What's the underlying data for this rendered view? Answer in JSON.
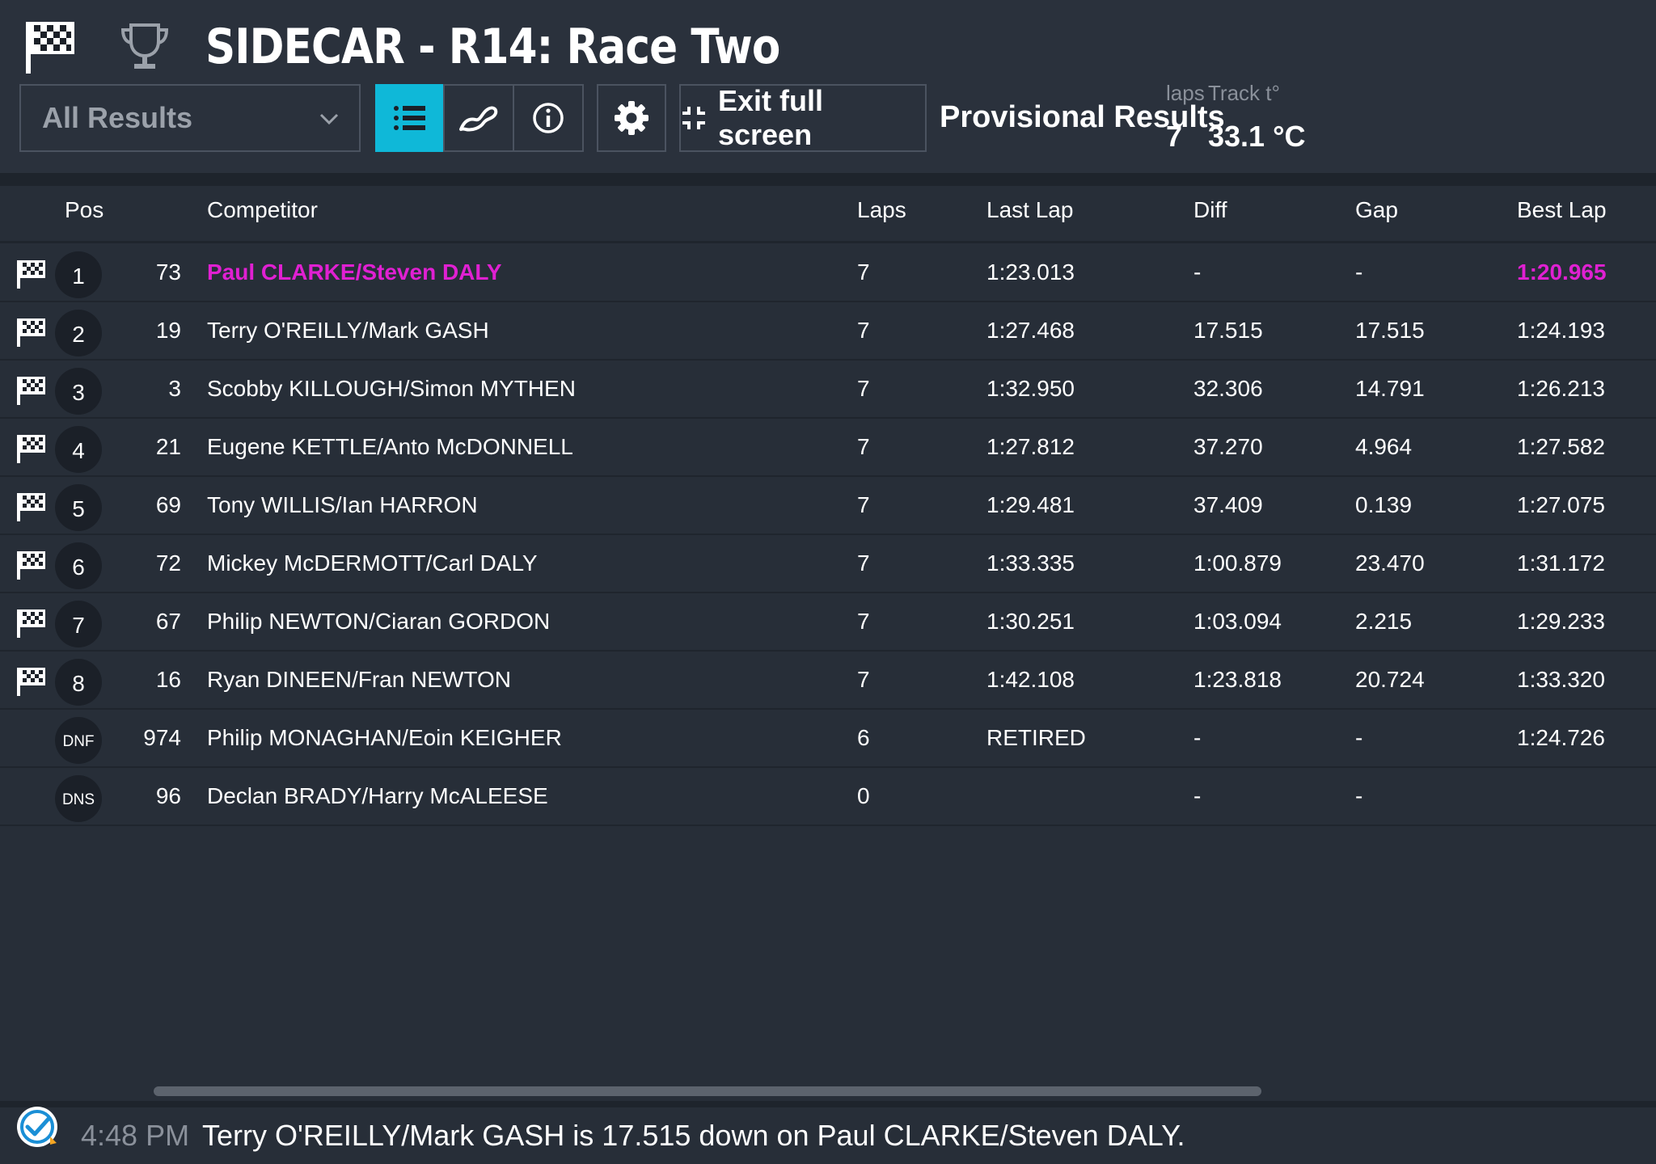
{
  "header": {
    "title": "SIDECAR - R14: Race Two",
    "dropdown_label": "All Results",
    "exit_label": "Exit full screen",
    "status": "Provisional Results",
    "laps_label": "laps",
    "laps_value": "7",
    "track_label": "Track t°",
    "track_value": "33.1 °C",
    "active_view": "list"
  },
  "columns": {
    "pos": "Pos",
    "competitor": "Competitor",
    "laps": "Laps",
    "last_lap": "Last Lap",
    "diff": "Diff",
    "gap": "Gap",
    "best_lap": "Best Lap"
  },
  "rows": [
    {
      "pos": "1",
      "num": "73",
      "competitor": "Paul CLARKE/Steven DALY",
      "laps": "7",
      "last": "1:23.013",
      "diff": "-",
      "gap": "-",
      "best": "1:20.965",
      "flag": true,
      "leader": true
    },
    {
      "pos": "2",
      "num": "19",
      "competitor": "Terry O'REILLY/Mark GASH",
      "laps": "7",
      "last": "1:27.468",
      "diff": "17.515",
      "gap": "17.515",
      "best": "1:24.193",
      "flag": true
    },
    {
      "pos": "3",
      "num": "3",
      "competitor": "Scobby KILLOUGH/Simon MYTHEN",
      "laps": "7",
      "last": "1:32.950",
      "diff": "32.306",
      "gap": "14.791",
      "best": "1:26.213",
      "flag": true
    },
    {
      "pos": "4",
      "num": "21",
      "competitor": "Eugene KETTLE/Anto McDONNELL",
      "laps": "7",
      "last": "1:27.812",
      "diff": "37.270",
      "gap": "4.964",
      "best": "1:27.582",
      "flag": true
    },
    {
      "pos": "5",
      "num": "69",
      "competitor": "Tony WILLIS/Ian HARRON",
      "laps": "7",
      "last": "1:29.481",
      "diff": "37.409",
      "gap": "0.139",
      "best": "1:27.075",
      "flag": true
    },
    {
      "pos": "6",
      "num": "72",
      "competitor": "Mickey McDERMOTT/Carl DALY",
      "laps": "7",
      "last": "1:33.335",
      "diff": "1:00.879",
      "gap": "23.470",
      "best": "1:31.172",
      "flag": true
    },
    {
      "pos": "7",
      "num": "67",
      "competitor": "Philip NEWTON/Ciaran GORDON",
      "laps": "7",
      "last": "1:30.251",
      "diff": "1:03.094",
      "gap": "2.215",
      "best": "1:29.233",
      "flag": true
    },
    {
      "pos": "8",
      "num": "16",
      "competitor": "Ryan DINEEN/Fran NEWTON",
      "laps": "7",
      "last": "1:42.108",
      "diff": "1:23.818",
      "gap": "20.724",
      "best": "1:33.320",
      "flag": true
    },
    {
      "pos": "DNF",
      "num": "974",
      "competitor": "Philip MONAGHAN/Eoin KEIGHER",
      "laps": "6",
      "last": "RETIRED",
      "diff": "-",
      "gap": "-",
      "best": "1:24.726",
      "flag": false
    },
    {
      "pos": "DNS",
      "num": "96",
      "competitor": "Declan BRADY/Harry McALEESE",
      "laps": "0",
      "last": "",
      "diff": "-",
      "gap": "-",
      "best": "",
      "flag": false
    }
  ],
  "footer": {
    "time": "4:48 PM",
    "message": "Terry O'REILLY/Mark GASH is 17.515 down on Paul CLARKE/Steven DALY."
  },
  "colors": {
    "accent": "#0fb8d8",
    "leader": "#e020d2",
    "background": "#272e38"
  }
}
